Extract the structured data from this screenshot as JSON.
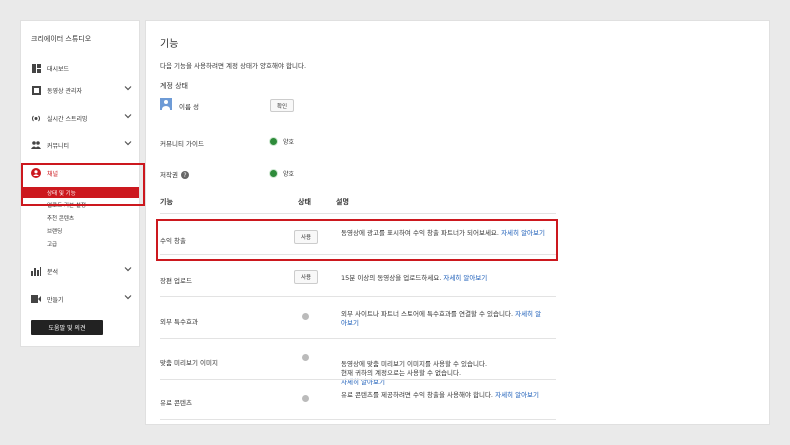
{
  "sidebar": {
    "title": "크리에이터 스튜디오",
    "items": [
      {
        "label": "대시보드",
        "icon": "dashboard-icon"
      },
      {
        "label": "동영상 관리자",
        "icon": "video-manager-icon"
      },
      {
        "label": "실시간 스트리밍",
        "icon": "live-streaming-icon"
      },
      {
        "label": "커뮤니티",
        "icon": "community-icon"
      },
      {
        "label": "채널",
        "icon": "channel-icon"
      },
      {
        "label": "분석",
        "icon": "analytics-icon"
      },
      {
        "label": "만들기",
        "icon": "create-icon"
      }
    ],
    "channel_sub": [
      "상태 및 기능",
      "업로드 기본 설정",
      "추천 콘텐츠",
      "브랜딩",
      "고급"
    ],
    "help_button": "도움말 및 의견"
  },
  "main": {
    "title": "기능",
    "description": "다음 기능을 사용하려면 계정 상태가 양호해야 합니다.",
    "account_status_label": "계정 상태",
    "account_name": "이름 성",
    "confirm_button": "확인",
    "community_guidelines": "커뮤니티 가이드",
    "copyright": "저작권",
    "good": "양호",
    "headers": {
      "feature": "기능",
      "status": "상태",
      "description": "설명"
    },
    "features": [
      {
        "name": "수익 창출",
        "button": "사용",
        "desc": "동영상에 광고를 표시하여 수익 창출 파트너가 되어보세요.",
        "link": "자세히 알아보기"
      },
      {
        "name": "장편 업로드",
        "button": "사용",
        "desc": "15분 이상의 동영상을 업로드하세요.",
        "link": "자세히 알아보기"
      },
      {
        "name": "외부 특수효과",
        "desc": "외부 사이트나 파트너 스토어에 특수효과를 연결할 수 있습니다.",
        "link": "자세히 알아보기"
      },
      {
        "name": "맞춤 미리보기 이미지",
        "desc": "동영상에 맞춤 미리보기 이미지를 사용할 수 있습니다.\n현재 귀하의 계정으로는 사용할 수 없습니다.",
        "link": "자세히 알아보기"
      },
      {
        "name": "유료 콘텐츠",
        "desc": "유료 콘텐츠를 제공하려면 수익 창출을 사용해야 합니다.",
        "link": "자세히 알아보기"
      }
    ]
  },
  "colors": {
    "accent_red": "#cc181e",
    "link_blue": "#1a5cb8",
    "status_green": "#2e8b3a"
  }
}
